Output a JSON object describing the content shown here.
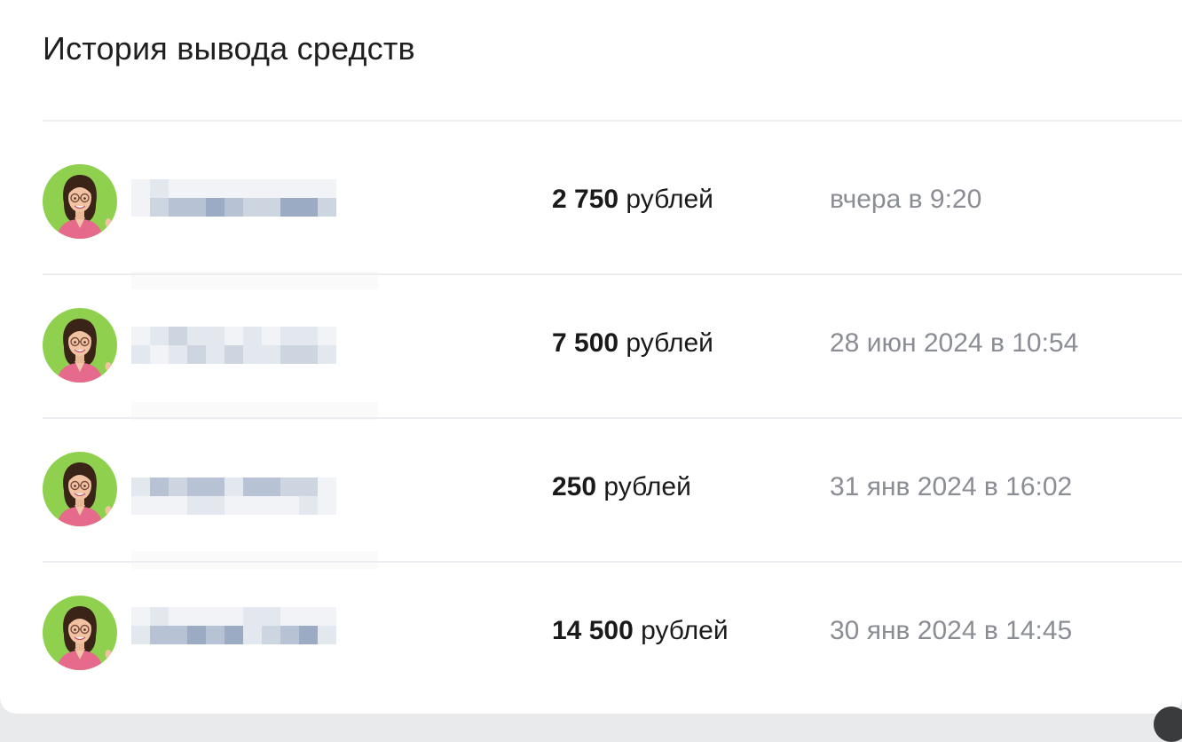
{
  "panel": {
    "title": "История вывода средств"
  },
  "withdrawals": [
    {
      "amount": "2 750",
      "currency": "рублей",
      "when": "вчера в 9:20"
    },
    {
      "amount": "7 500",
      "currency": "рублей",
      "when": "28 июн 2024 в 10:54"
    },
    {
      "amount": "250",
      "currency": "рублей",
      "when": "31 янв 2024 в 16:02"
    },
    {
      "amount": "14 500",
      "currency": "рублей",
      "when": "30 янв 2024 в 14:45"
    }
  ],
  "colors": {
    "avatar_background": "#8fd14f",
    "blur_palette": [
      "#f2f3f6",
      "#e3e7ee",
      "#cdd5e1",
      "#b7c3d5",
      "#9aabc3"
    ]
  }
}
